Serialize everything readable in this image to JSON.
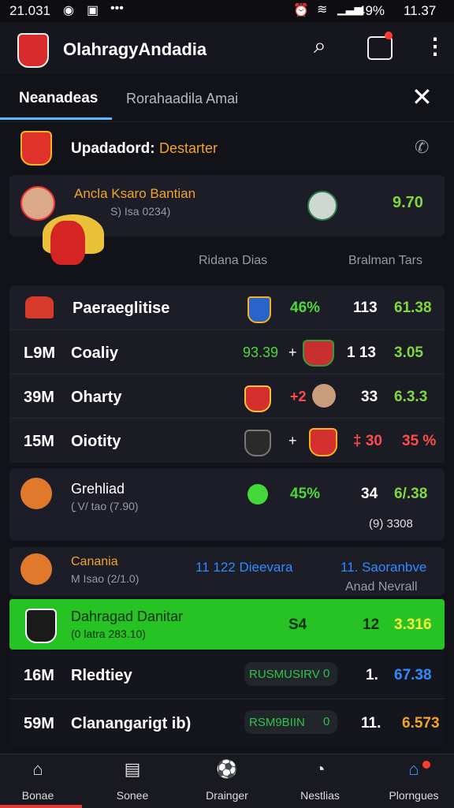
{
  "status": {
    "time": "21.031",
    "battery": "49%",
    "clock": "11.37"
  },
  "appbar": {
    "title": "OlahragyAndadia"
  },
  "tabs": [
    {
      "label": "Neanadeas"
    },
    {
      "label": "Rorahaadila Amai"
    }
  ],
  "section": {
    "title": "Upadadord:",
    "subtitle": "Destarter"
  },
  "featured": {
    "name": "Ancla Ksaro Bantian",
    "sub": "S) Isa 0234)",
    "score": "9.70"
  },
  "columns": {
    "left": "Ridana Dias",
    "right": "Bralman Tars"
  },
  "group_row": {
    "name": "Paeraeglitise",
    "pct": "46%",
    "count": "113",
    "score": "61.38"
  },
  "rows": [
    {
      "amount": "L9M",
      "name": "Coaliy",
      "odds": "93.39",
      "plus": "+",
      "count": "1 13",
      "score": "3.05"
    },
    {
      "amount": "39M",
      "name": "Oharty",
      "odds": "",
      "plus": "+2",
      "count": "33",
      "score": "6.3.3"
    },
    {
      "amount": "15M",
      "name": "Oiotity",
      "odds": "",
      "plus": "+",
      "count": "‡ 30",
      "score": "35 %"
    }
  ],
  "player1": {
    "name": "Grehliad",
    "sub": "(̱ V/ tao (7.90)",
    "pct": "45%",
    "count": "34",
    "score": "6/.38",
    "extra": "(9) 3308"
  },
  "player2": {
    "name": "Canania",
    "sub": "M Isao (2/1.0)",
    "middle": "11 122 Dieevara",
    "right": "11. Saoranbve",
    "extra": "Anad Nevrall"
  },
  "highlight": {
    "name": "Dahragad Danitar",
    "sub": "(0 latra 283.10)",
    "mid": "S4",
    "count": "12",
    "score": "3.316"
  },
  "rows2": [
    {
      "amount": "16M",
      "name": "Rledtiey",
      "pill": "RUSMUSIRV",
      "pill_n": "0",
      "count": "1.",
      "score": "67.38"
    },
    {
      "amount": "59M",
      "name": "Clanangarigt ib)",
      "pill": "RSM9BIIN",
      "pill_n": "0",
      "count": "11.",
      "score": "6.573"
    }
  ],
  "nav": [
    {
      "label": "Bonae"
    },
    {
      "label": "Sonee"
    },
    {
      "label": "Drainger"
    },
    {
      "label": "Nestlias"
    },
    {
      "label": "Plorngues"
    }
  ]
}
